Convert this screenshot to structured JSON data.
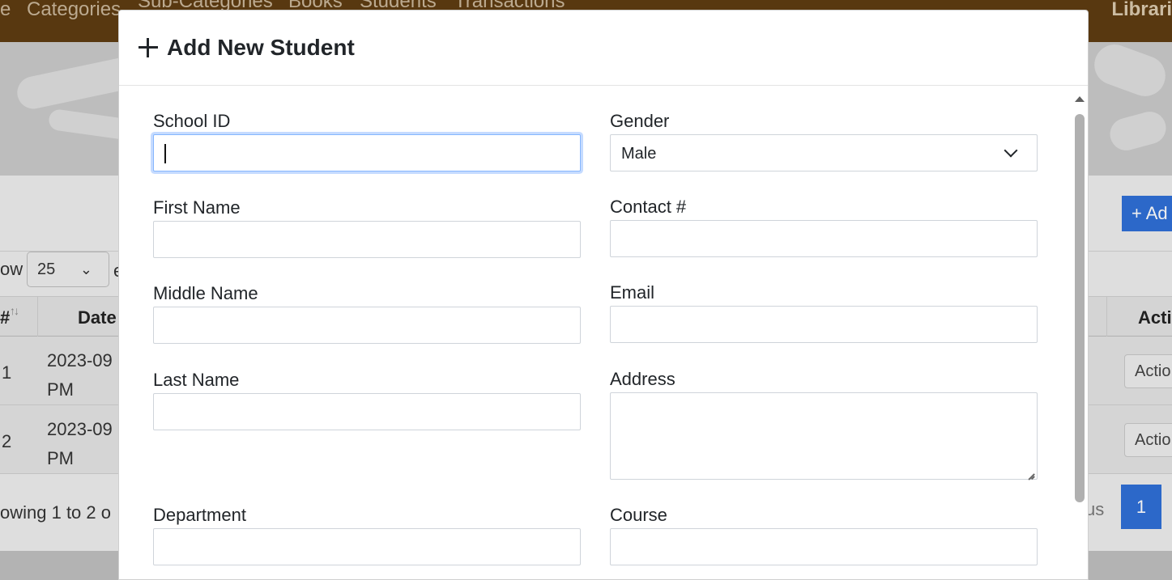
{
  "background": {
    "nav": {
      "items": [
        "e",
        "Categories",
        "Sub-Categories",
        "Books",
        "Students",
        "Transactions"
      ],
      "brand": "Librari"
    },
    "add_button": "+ Ad",
    "show_label": "ow",
    "entries_value": "25",
    "entries_tail": "e",
    "table": {
      "headers": {
        "num": "#",
        "date": "Date",
        "action": "Acti"
      },
      "rows": [
        {
          "num": "1",
          "date_line1": "2023-09",
          "date_line2": "PM",
          "action": "Actio"
        },
        {
          "num": "2",
          "date_line1": "2023-09",
          "date_line2": "PM",
          "action": "Actio"
        }
      ]
    },
    "footer_info": "owing 1 to 2 o",
    "pagination": {
      "previous": "us",
      "current_page": "1"
    }
  },
  "modal": {
    "title": "Add New Student",
    "fields": {
      "school_id": {
        "label": "School ID",
        "value": ""
      },
      "gender": {
        "label": "Gender",
        "value": "Male"
      },
      "first_name": {
        "label": "First Name",
        "value": ""
      },
      "contact": {
        "label": "Contact #",
        "value": ""
      },
      "middle_name": {
        "label": "Middle Name",
        "value": ""
      },
      "email": {
        "label": "Email",
        "value": ""
      },
      "last_name": {
        "label": "Last Name",
        "value": ""
      },
      "address": {
        "label": "Address",
        "value": ""
      },
      "department": {
        "label": "Department",
        "value": ""
      },
      "course": {
        "label": "Course",
        "value": ""
      }
    }
  },
  "colors": {
    "navbar": "#5e3c12",
    "primary": "#2f6fd6",
    "focus_ring": "#86b7fe"
  }
}
